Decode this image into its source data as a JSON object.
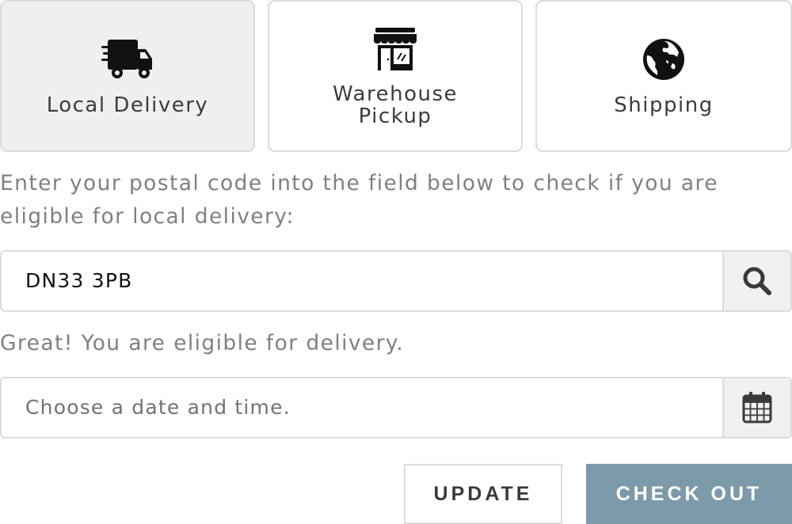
{
  "delivery_options": {
    "local": {
      "label": "Local Delivery",
      "icon": "truck-icon",
      "selected": true
    },
    "warehouse": {
      "label_line1": "Warehouse",
      "label_line2": "Pickup",
      "icon": "storefront-icon"
    },
    "shipping": {
      "label": "Shipping",
      "icon": "globe-icon"
    }
  },
  "intro_text": "Enter your postal code into the field below to check if you are eligible for local delivery:",
  "postal_code": {
    "value": "DN33 3PB",
    "search_icon": "search-icon"
  },
  "status_text": "Great! You are eligible for delivery.",
  "date_field": {
    "placeholder": "Choose a date and time.",
    "icon": "calendar-icon"
  },
  "actions": {
    "update_label": "UPDATE",
    "checkout_label": "CHECK OUT"
  },
  "colors": {
    "selected_bg": "#efefef",
    "border": "#dcdcdc",
    "checkout_bg": "#7d9aaa",
    "muted_text": "#7b8186"
  }
}
